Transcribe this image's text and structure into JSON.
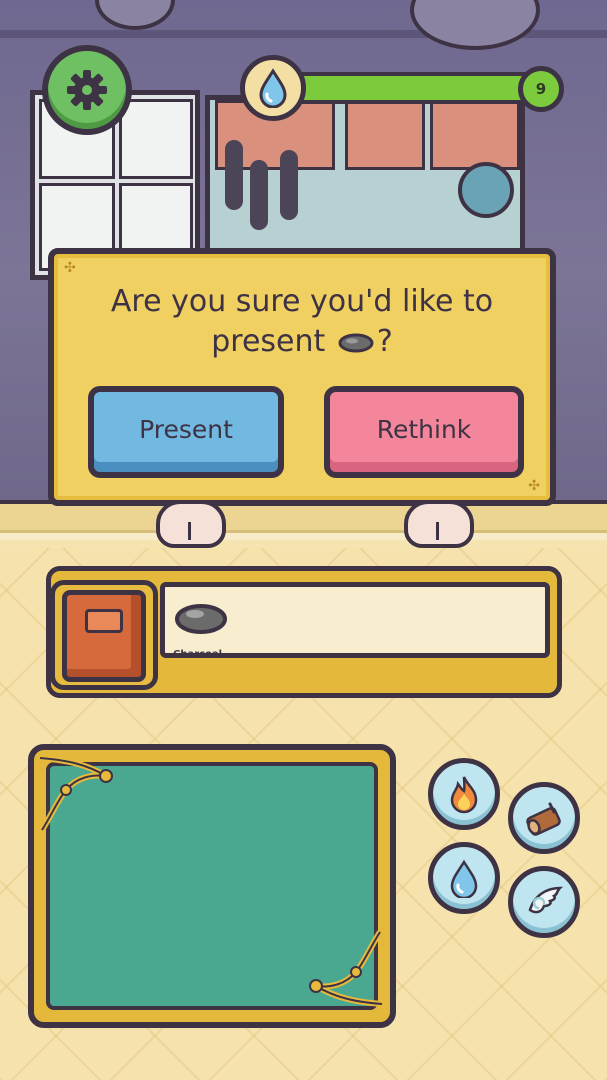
{
  "hud": {
    "settings_icon": "gear-icon",
    "mana_icon": "water-drop-icon",
    "mana_level": 9,
    "mana_fill_fraction": 0.97
  },
  "dialog": {
    "question_line1": "Are you sure you'd like to",
    "question_line2": "present",
    "question_end": "?",
    "item_icon": "charcoal-icon",
    "present_label": "Present",
    "rethink_label": "Rethink"
  },
  "inventory": {
    "book_icon": "recipe-book-icon",
    "items": [
      {
        "name": "Charcoal",
        "icon": "charcoal-icon"
      }
    ]
  },
  "elements": [
    {
      "name": "fire",
      "icon": "fire-icon"
    },
    {
      "name": "wood",
      "icon": "wood-log-icon"
    },
    {
      "name": "water",
      "icon": "water-drop-icon"
    },
    {
      "name": "air",
      "icon": "wing-icon"
    }
  ],
  "colors": {
    "dialog_bg": "#f1d062",
    "present_button": "#72b9e2",
    "rethink_button": "#f4869c",
    "mana_bar": "#7ccb3d",
    "board": "#4aa891",
    "outline": "#3d3344"
  }
}
